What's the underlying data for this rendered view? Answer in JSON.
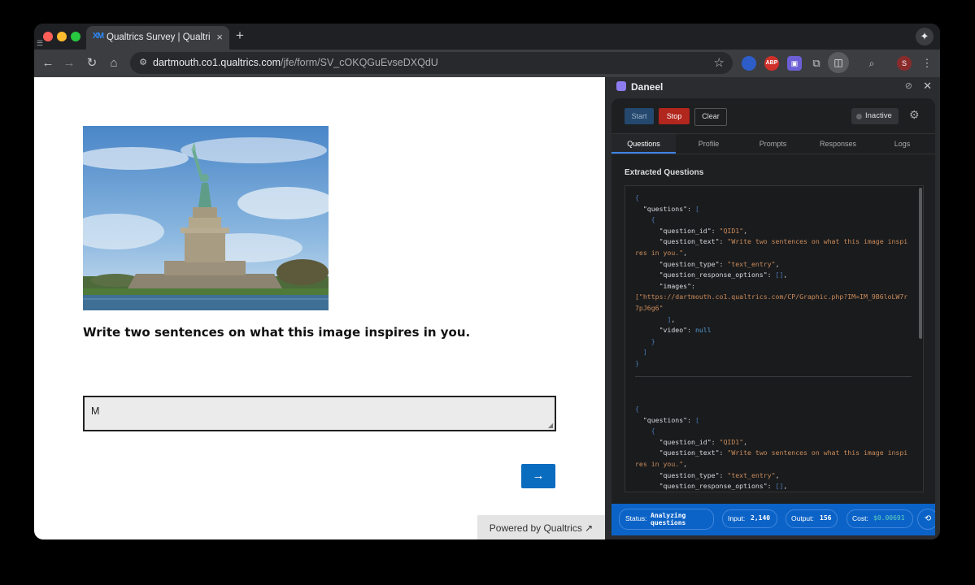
{
  "browser": {
    "tab_title": "Qualtrics Survey | Qualtrics E",
    "tab_close": "×",
    "new_tab": "+",
    "url_host": "dartmouth.co1.qualtrics.com",
    "url_path": "/jfe/form/SV_cOKQGuEvseDXQdU",
    "profile_initial": "S",
    "extension_icons": [
      "shield-icon",
      "abp-icon",
      "daneel-icon",
      "puzzle-icon",
      "side-panel-icon",
      "search-lens-icon"
    ]
  },
  "survey": {
    "question": "Write two sentences on what this image inspires in you.",
    "answer_value": "M",
    "next_label": "→",
    "powered_by": "Powered by Qualtrics",
    "image_subject": "statue-of-liberty-photo"
  },
  "panel": {
    "title": "Daneel",
    "buttons": {
      "start": "Start",
      "stop": "Stop",
      "clear": "Clear"
    },
    "state": "Inactive",
    "tabs": [
      "Questions",
      "Profile",
      "Prompts",
      "Responses",
      "Logs"
    ],
    "active_tab": "Questions",
    "section_title": "Extracted Questions",
    "extracted": [
      {
        "question_id": "QID1",
        "question_text": "Write two sentences on what this image inspires in you.",
        "question_type": "text_entry",
        "question_response_options": "[]",
        "images": "https://dartmouth.co1.qualtrics.com/CP/Graphic.php?IM=IM_9B6loLW7r7pJ6g6",
        "video": "null"
      },
      {
        "question_id": "QID1",
        "question_text": "Write two sentences on what this image inspires in you.",
        "question_type": "text_entry",
        "question_response_options": "[]"
      }
    ],
    "status": {
      "status_label": "Status:",
      "status_value_1": "Analyzing",
      "status_value_2": "questions",
      "input_label": "Input:",
      "input_value": "2,140",
      "output_label": "Output:",
      "output_value": "156",
      "cost_label": "Cost:",
      "cost_value": "$0.00691"
    }
  }
}
